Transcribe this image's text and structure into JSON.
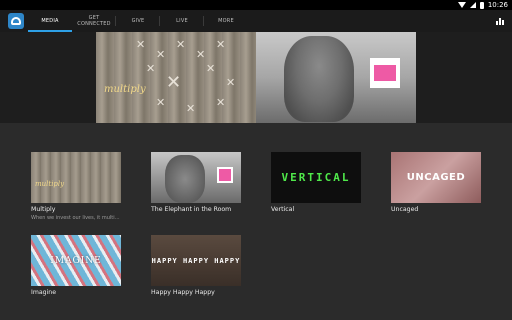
{
  "status": {
    "time": "10:26"
  },
  "tabs": [
    {
      "label": "MEDIA",
      "active": true
    },
    {
      "label": "GET CONNECTED",
      "active": false
    },
    {
      "label": "GIVE",
      "active": false
    },
    {
      "label": "LIVE",
      "active": false
    },
    {
      "label": "MORE",
      "active": false
    }
  ],
  "hero": {
    "left_word": "multiply"
  },
  "series": [
    {
      "title": "Multiply",
      "subtitle": "When we invest our lives, it multipli...",
      "thumb_text": "multiply"
    },
    {
      "title": "The Elephant in the Room",
      "subtitle": "",
      "thumb_text": ""
    },
    {
      "title": "Vertical",
      "subtitle": "",
      "thumb_text": "VERTICAL"
    },
    {
      "title": "Uncaged",
      "subtitle": "",
      "thumb_text": "UNCAGED"
    },
    {
      "title": "Imagine",
      "subtitle": "",
      "thumb_text": "IMAGINE"
    },
    {
      "title": "Happy Happy Happy",
      "subtitle": "",
      "thumb_text": "HAPPY HAPPY HAPPY"
    }
  ],
  "colors": {
    "accent": "#2ea0e6",
    "background": "#2b2b2b",
    "action_bar": "#1b1b1b"
  },
  "icons": {
    "app": "church-app-logo-icon",
    "stats": "bar-chart-icon"
  }
}
